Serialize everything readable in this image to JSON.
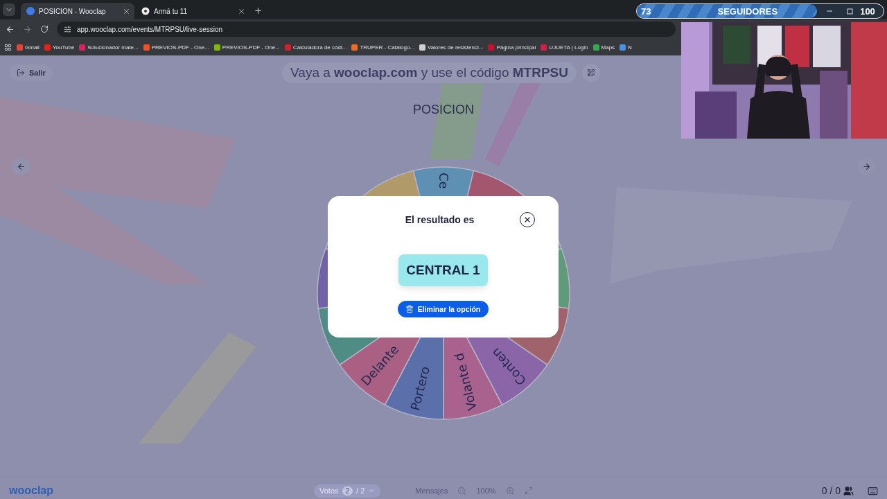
{
  "browser": {
    "tabs": [
      {
        "title": "POSICION - Wooclap",
        "selected": true
      },
      {
        "title": "Armá tu 11",
        "selected": false
      }
    ],
    "address": "app.wooclap.com/events/MTRPSU/live-session",
    "bookmarks": [
      {
        "label": "Gmail",
        "color": "#ea4335"
      },
      {
        "label": "YouTube",
        "color": "#e62117"
      },
      {
        "label": "Solucionador mate...",
        "color": "#d6245c"
      },
      {
        "label": "PREVIOS-PDF - One...",
        "color": "#f25022"
      },
      {
        "label": "PREVIOS-PDF - One...",
        "color": "#7fba00"
      },
      {
        "label": "Calculadora de códi...",
        "color": "#d3202a"
      },
      {
        "label": "TRUPER - Catálogo...",
        "color": "#f26b21"
      },
      {
        "label": "Valores de resistenci...",
        "color": "#cfcfcf"
      },
      {
        "label": "Página principal",
        "color": "#c8102e"
      },
      {
        "label": "UJUETA | Login",
        "color": "#d02048"
      },
      {
        "label": "Maps",
        "color": "#34a853"
      },
      {
        "label": "N",
        "color": "#4a8fe0"
      }
    ]
  },
  "stream_overlay": {
    "left_count": "73",
    "label": "SEGUIDORES",
    "right_count": "100",
    "level": 0.73
  },
  "header": {
    "exit_button": "Salir",
    "join_message": "Vaya a **wooclap.com** y use el código **MTRPSU**"
  },
  "question_title": "POSICION",
  "wheel": {
    "segments": [
      {
        "label": "Ce",
        "color": "#5e90b4"
      },
      {
        "color": "#a2576e"
      },
      {
        "color": "#6f9a7e"
      },
      {
        "color": "#5f9a7b"
      },
      {
        "color": "#a0636b"
      },
      {
        "label": "Conten",
        "color": "#8a66a8"
      },
      {
        "label": "Volante d",
        "color": "#a9628d"
      },
      {
        "label": "Portero",
        "color": "#5b70ab"
      },
      {
        "label": "Delante",
        "color": "#a96083"
      },
      {
        "color": "#4f8d84"
      },
      {
        "color": "#6f62a8"
      },
      {
        "color": "#8a7bb0"
      },
      {
        "color": "#b09a6a"
      }
    ]
  },
  "modal": {
    "title": "El resultado es",
    "result": "CENTRAL 1",
    "delete_button": "Eliminar la opción"
  },
  "footer": {
    "logo": "wooclap",
    "votes_label": "Votos",
    "votes_count": "2",
    "votes_total": "/ 2",
    "messages": "Mensajes",
    "zoom": "100%",
    "participants": "0 / 0"
  }
}
